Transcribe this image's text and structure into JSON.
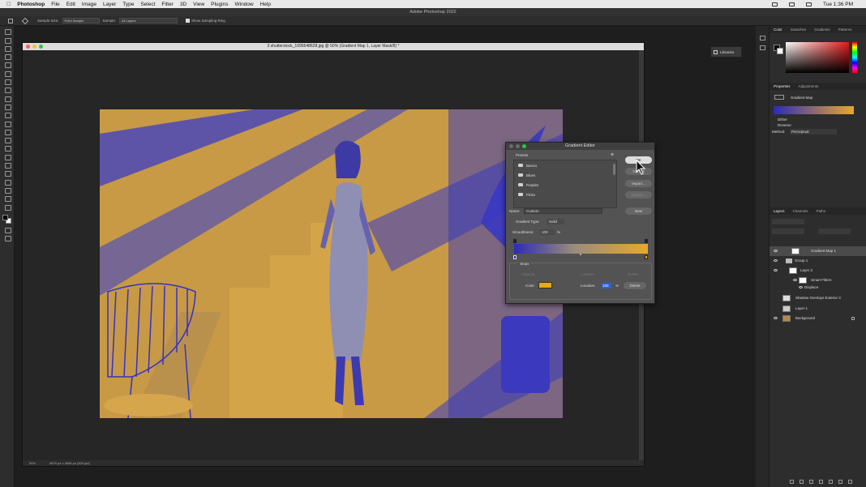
{
  "menubar": {
    "app": "Photoshop",
    "items": [
      "File",
      "Edit",
      "Image",
      "Layer",
      "Type",
      "Select",
      "Filter",
      "3D",
      "View",
      "Plugins",
      "Window",
      "Help"
    ],
    "clock": "Tue 1:36 PM"
  },
  "window_title": "Adobe Photoshop 2022",
  "options": {
    "sample_size_label": "Sample Size:",
    "sample_size_value": "Point Sample",
    "sample_label": "Sample:",
    "sample_value": "All Layers",
    "show_ring": "Show Sampling Ring"
  },
  "document": {
    "title": "3 shutterstock_1695648628.jpg @ 50% (Gradient Map 1, Layer Mask/8) *",
    "zoom": "50%",
    "dimensions": "6870 px x 3648 px (300 ppi)"
  },
  "libraries": "Libraries",
  "gradient_editor": {
    "title": "Gradient Editor",
    "presets_label": "Presets",
    "folders": [
      "Basics",
      "Blues",
      "Purples",
      "Pinks"
    ],
    "ok": "OK",
    "cancel": "Cancel",
    "import": "Import...",
    "export": "Export...",
    "name_label": "Name:",
    "name_value": "Custom",
    "new": "New",
    "type_label": "Gradient Type:",
    "type_value": "Solid",
    "smooth_label": "Smoothness:",
    "smooth_value": "100",
    "smooth_unit": "%",
    "stops_label": "Stops",
    "opacity_label": "Opacity:",
    "location_label": "Location:",
    "delete": "Delete",
    "color_label": "Color:",
    "color_value": "#e8a814",
    "location_value": "100",
    "location_unit": "%"
  },
  "panels": {
    "color_tabs": [
      "Color",
      "Swatches",
      "Gradients",
      "Patterns"
    ],
    "prop_tabs": [
      "Properties",
      "Adjustments"
    ],
    "prop_title": "Gradient Map",
    "dither": "Dither",
    "reverse": "Reverse",
    "method_label": "Method:",
    "method_value": "Perceptual",
    "layer_tabs": [
      "Layers",
      "Channels",
      "Paths"
    ],
    "layers": [
      "Gradient Map 1",
      "Group 1",
      "Layer 2",
      "Smart Filters",
      "Displace",
      "Shadow Overlays Exterior 3",
      "Layer 1",
      "Background"
    ]
  }
}
